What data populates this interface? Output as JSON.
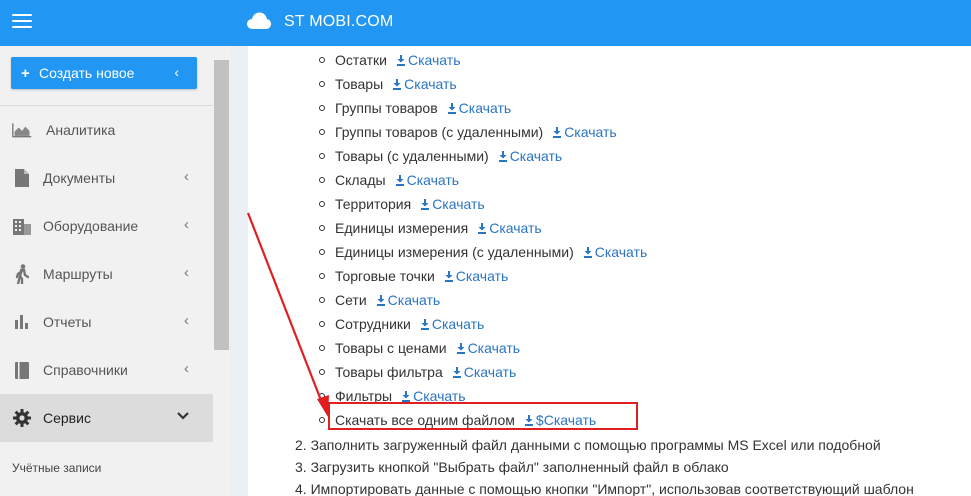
{
  "app": {
    "brand": "ST MOBI.COM"
  },
  "sidebar": {
    "create_label": "Создать новое",
    "items": [
      {
        "label": "Аналитика",
        "icon": "chart-area-icon",
        "arrow": ""
      },
      {
        "label": "Документы",
        "icon": "file-icon",
        "arrow": "‹"
      },
      {
        "label": "Оборудование",
        "icon": "building-icon",
        "arrow": "‹"
      },
      {
        "label": "Маршруты",
        "icon": "walking-icon",
        "arrow": "‹"
      },
      {
        "label": "Отчеты",
        "icon": "bar-chart-icon",
        "arrow": "‹"
      },
      {
        "label": "Справочники",
        "icon": "book-icon",
        "arrow": "‹"
      },
      {
        "label": "Сервис",
        "icon": "gear-icon",
        "arrow": "⌄"
      }
    ],
    "sub_label": "Учётные записи"
  },
  "content": {
    "download_label": "Скачать",
    "files": [
      {
        "name": "Остатки",
        "link": "Скачать"
      },
      {
        "name": "Товары",
        "link": "Скачать"
      },
      {
        "name": "Группы товаров",
        "link": "Скачать"
      },
      {
        "name": "Группы товаров (с удаленными)",
        "link": "Скачать"
      },
      {
        "name": "Товары (с удаленными)",
        "link": "Скачать"
      },
      {
        "name": "Склады",
        "link": "Скачать"
      },
      {
        "name": "Территория",
        "link": "Скачать"
      },
      {
        "name": "Единицы измерения",
        "link": "Скачать"
      },
      {
        "name": "Единицы измерения (с удаленными)",
        "link": "Скачать"
      },
      {
        "name": "Торговые точки",
        "link": "Скачать"
      },
      {
        "name": "Сети",
        "link": "Скачать"
      },
      {
        "name": "Сотрудники",
        "link": "Скачать"
      },
      {
        "name": "Товары с ценами",
        "link": "Скачать"
      },
      {
        "name": "Товары фильтра",
        "link": "Скачать"
      },
      {
        "name": "Фильтры",
        "link": "Скачать"
      },
      {
        "name": "Скачать все одним файлом",
        "link": "$Скачать"
      }
    ],
    "steps": [
      "2. Заполнить загруженный файл данными с помощью программы MS Excel или подобной",
      "3. Загрузить кнопкой \"Выбрать файл\" заполненный файл в облако",
      "4. Импортировать данные с помощью кнопки \"Импорт\", использовав соответствующий шаблон"
    ]
  },
  "colors": {
    "accent": "#2196f3",
    "link": "#2a74c5",
    "highlight": "#e02020"
  }
}
